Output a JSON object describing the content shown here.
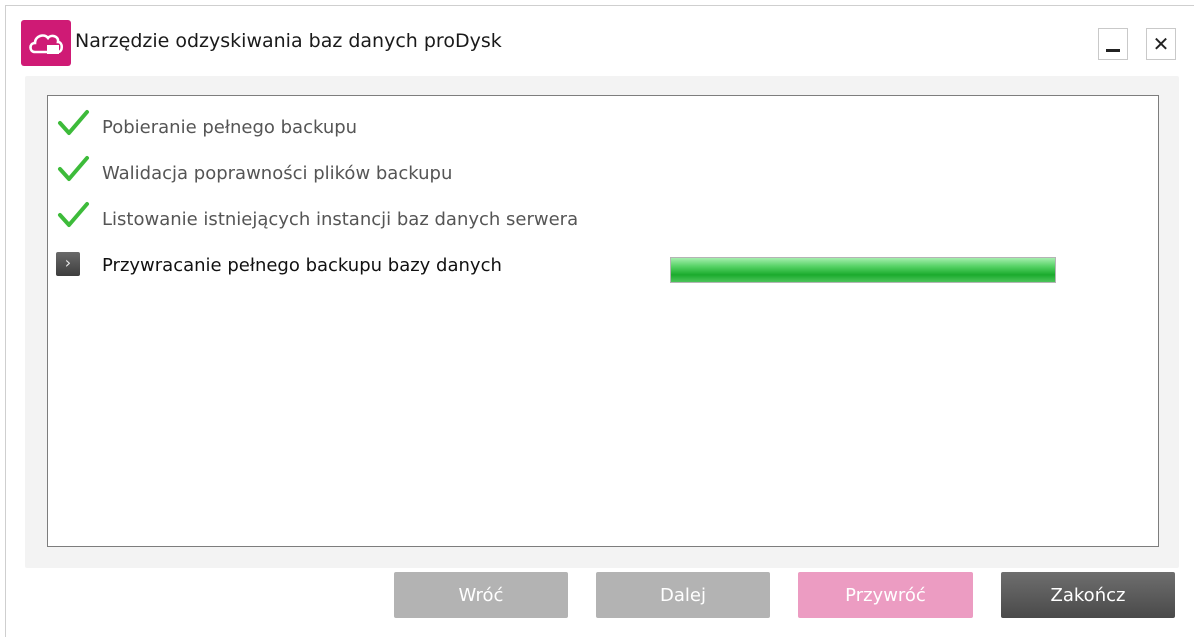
{
  "window": {
    "title": "Narzędzie odzyskiwania baz danych proDysk",
    "accent_color": "#cf1a75",
    "app_icon": "cloud-icon",
    "minimize_icon": "minimize-icon",
    "close_icon": "close-icon",
    "close_glyph": "✕"
  },
  "steps": [
    {
      "label": "Pobieranie pełnego backupu",
      "status": "done",
      "icon": "check-icon"
    },
    {
      "label": "Walidacja poprawności plików backupu",
      "status": "done",
      "icon": "check-icon"
    },
    {
      "label": "Listowanie istniejących instancji baz danych serwera",
      "status": "done",
      "icon": "check-icon"
    },
    {
      "label": "Przywracanie pełnego backupu bazy danych",
      "status": "in-progress",
      "icon": "chevron-right-icon",
      "progress": 1.0
    }
  ],
  "buttons": {
    "back": "Wróć",
    "next": "Dalej",
    "restore": "Przywróć",
    "finish": "Zakończ"
  }
}
